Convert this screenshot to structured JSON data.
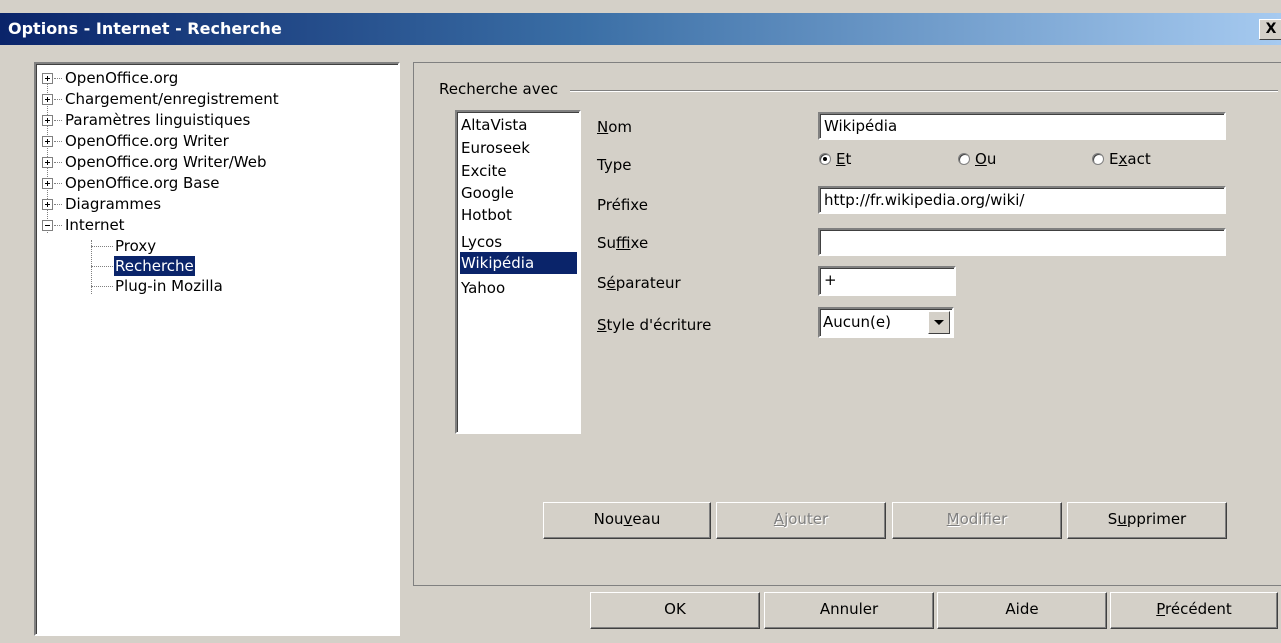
{
  "window": {
    "title": "Options - Internet - Recherche",
    "close_label": "X"
  },
  "tree": {
    "items": [
      {
        "label": "OpenOffice.org",
        "expander": "plus"
      },
      {
        "label": "Chargement/enregistrement",
        "expander": "plus"
      },
      {
        "label": "Paramètres linguistiques",
        "expander": "plus"
      },
      {
        "label": "OpenOffice.org Writer",
        "expander": "plus"
      },
      {
        "label": "OpenOffice.org Writer/Web",
        "expander": "plus"
      },
      {
        "label": "OpenOffice.org Base",
        "expander": "plus"
      },
      {
        "label": "Diagrammes",
        "expander": "plus"
      },
      {
        "label": "Internet",
        "expander": "minus"
      }
    ],
    "children": [
      {
        "label": "Proxy"
      },
      {
        "label": "Recherche",
        "selected": true
      },
      {
        "label": "Plug-in Mozilla"
      }
    ]
  },
  "search": {
    "group_label": "Recherche avec",
    "engines": [
      "AltaVista",
      "Euroseek",
      "Excite",
      "Google",
      "Hotbot",
      "Lycos",
      "Wikipédia",
      "Yahoo"
    ],
    "selected_engine": "Wikipédia",
    "fields": {
      "nom": {
        "label_pre": "",
        "label_u": "N",
        "label_post": "om",
        "value": "Wikipédia"
      },
      "type": {
        "label": "Type",
        "options": [
          {
            "pre": "",
            "u": "E",
            "post": "t",
            "checked": true
          },
          {
            "pre": "",
            "u": "O",
            "post": "u",
            "checked": false
          },
          {
            "pre": "E",
            "u": "x",
            "post": "act",
            "checked": false
          }
        ]
      },
      "prefixe": {
        "label_pre": "Préf",
        "label_u": "i",
        "label_post": "xe",
        "value": "http://fr.wikipedia.org/wiki/"
      },
      "suffixe": {
        "label_pre": "Su",
        "label_u": "f",
        "label_post": "fixe",
        "value": ""
      },
      "separateur": {
        "label_pre": "S",
        "label_u": "é",
        "label_post": "parateur",
        "value": "+"
      },
      "style": {
        "label_pre": "",
        "label_u": "S",
        "label_post": "tyle d'écriture",
        "value": "Aucun(e)"
      }
    },
    "buttons": {
      "nouveau": {
        "pre": "Nou",
        "u": "v",
        "post": "eau",
        "enabled": true
      },
      "ajouter": {
        "pre": "",
        "u": "A",
        "post": "jouter",
        "enabled": false
      },
      "modifier": {
        "pre": "",
        "u": "M",
        "post": "odifier",
        "enabled": false
      },
      "supprimer": {
        "pre": "S",
        "u": "u",
        "post": "pprimer",
        "enabled": true
      }
    }
  },
  "footer": {
    "ok": "OK",
    "annuler": "Annuler",
    "aide": "Aide",
    "precedent": {
      "pre": "",
      "u": "P",
      "post": "récédent"
    }
  }
}
